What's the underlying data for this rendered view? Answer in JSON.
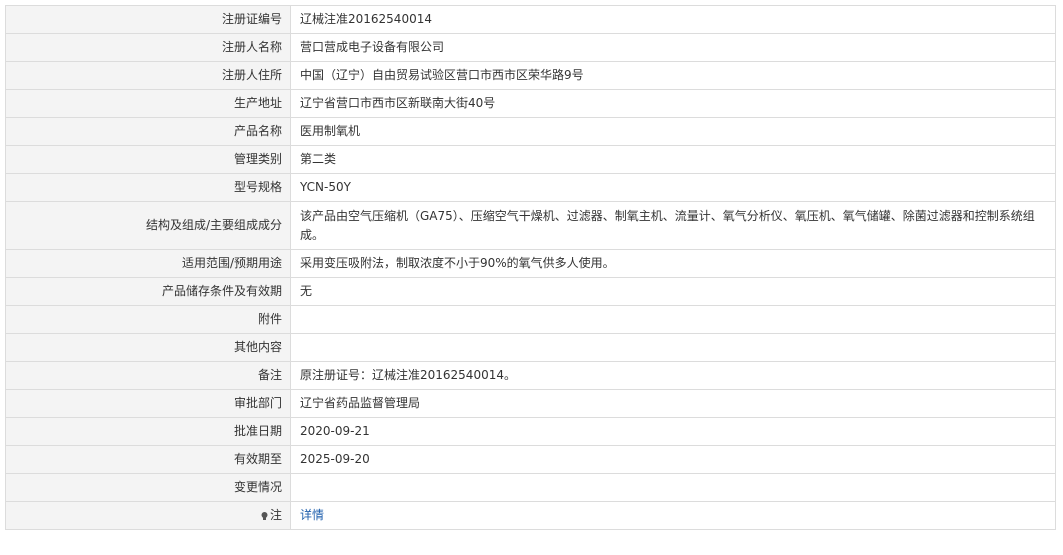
{
  "rows": [
    {
      "label": "注册证编号",
      "value": "辽械注准20162540014"
    },
    {
      "label": "注册人名称",
      "value": "营口营成电子设备有限公司"
    },
    {
      "label": "注册人住所",
      "value": "中国（辽宁）自由贸易试验区营口市西市区荣华路9号"
    },
    {
      "label": "生产地址",
      "value": "辽宁省营口市西市区新联南大街40号"
    },
    {
      "label": "产品名称",
      "value": "医用制氧机"
    },
    {
      "label": "管理类别",
      "value": "第二类"
    },
    {
      "label": "型号规格",
      "value": "YCN-50Y"
    },
    {
      "label": "结构及组成/主要组成成分",
      "value": "该产品由空气压缩机（GA75）、压缩空气干燥机、过滤器、制氧主机、流量计、氧气分析仪、氧压机、氧气储罐、除菌过滤器和控制系统组成。"
    },
    {
      "label": "适用范围/预期用途",
      "value": "采用变压吸附法，制取浓度不小于90%的氧气供多人使用。"
    },
    {
      "label": "产品储存条件及有效期",
      "value": "无"
    },
    {
      "label": "附件",
      "value": ""
    },
    {
      "label": "其他内容",
      "value": ""
    },
    {
      "label": "备注",
      "value": "原注册证号：辽械注准20162540014。"
    },
    {
      "label": "审批部门",
      "value": "辽宁省药品监督管理局"
    },
    {
      "label": "批准日期",
      "value": "2020-09-21"
    },
    {
      "label": "有效期至",
      "value": "2025-09-20"
    },
    {
      "label": "变更情况",
      "value": ""
    }
  ],
  "note": {
    "label": "注",
    "link": "详情",
    "icon": "lightbulb-icon"
  }
}
